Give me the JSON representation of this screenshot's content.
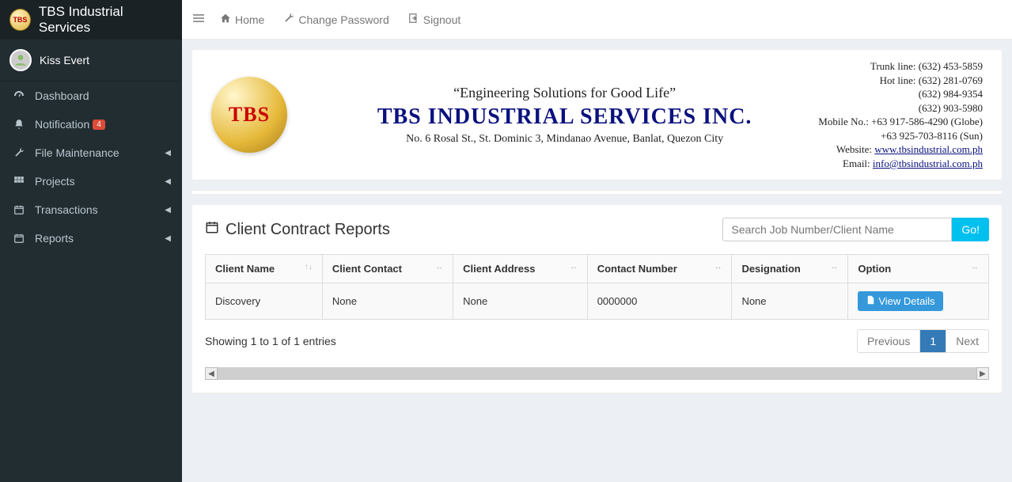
{
  "brand": {
    "logo_text": "TBS",
    "title": "TBS Industrial Services"
  },
  "user": {
    "name": "Kiss Evert"
  },
  "sidebar": {
    "items": [
      {
        "name": "dashboard",
        "icon": "gauge-icon",
        "label": "Dashboard",
        "badge": null,
        "expandable": false
      },
      {
        "name": "notification",
        "icon": "bell-icon",
        "label": "Notification",
        "badge": "4",
        "expandable": false
      },
      {
        "name": "file-maintenance",
        "icon": "wrench-icon",
        "label": "File Maintenance",
        "badge": null,
        "expandable": true
      },
      {
        "name": "projects",
        "icon": "grid-icon",
        "label": "Projects",
        "badge": null,
        "expandable": true
      },
      {
        "name": "transactions",
        "icon": "calendar-icon",
        "label": "Transactions",
        "badge": null,
        "expandable": true
      },
      {
        "name": "reports",
        "icon": "calendar-icon",
        "label": "Reports",
        "badge": null,
        "expandable": true
      }
    ]
  },
  "topnav": {
    "home": "Home",
    "change_password": "Change Password",
    "signout": "Signout"
  },
  "banner": {
    "globe_text": "TBS",
    "tagline": "“Engineering Solutions for Good Life”",
    "company": "TBS INDUSTRIAL SERVICES INC.",
    "address": "No. 6 Rosal St., St. Dominic 3, Mindanao Avenue, Banlat, Quezon City",
    "contact": {
      "trunk": "Trunk line: (632) 453-5859",
      "hot": "Hot line: (632) 281-0769",
      "l3": "(632) 984-9354",
      "l4": "(632) 903-5980",
      "mobile1": "Mobile No.: +63 917-586-4290 (Globe)",
      "mobile2": "+63 925-703-8116 (Sun)",
      "website_label": "Website: ",
      "website": "www.tbsindustrial.com.ph",
      "email_label": "Email: ",
      "email": "info@tbsindustrial.com.ph"
    }
  },
  "report": {
    "title": "Client Contract Reports",
    "search_placeholder": "Search Job Number/Client Name",
    "go_label": "Go!",
    "columns": {
      "client_name": "Client Name",
      "client_contact": "Client Contact",
      "client_address": "Client Address",
      "contact_number": "Contact Number",
      "designation": "Designation",
      "option": "Option"
    },
    "rows": [
      {
        "client_name": "Discovery",
        "client_contact": "None",
        "client_address": "None",
        "contact_number": "0000000",
        "designation": "None"
      }
    ],
    "view_details_label": "View Details",
    "info": "Showing 1 to 1 of 1 entries",
    "prev": "Previous",
    "page": "1",
    "next": "Next"
  }
}
